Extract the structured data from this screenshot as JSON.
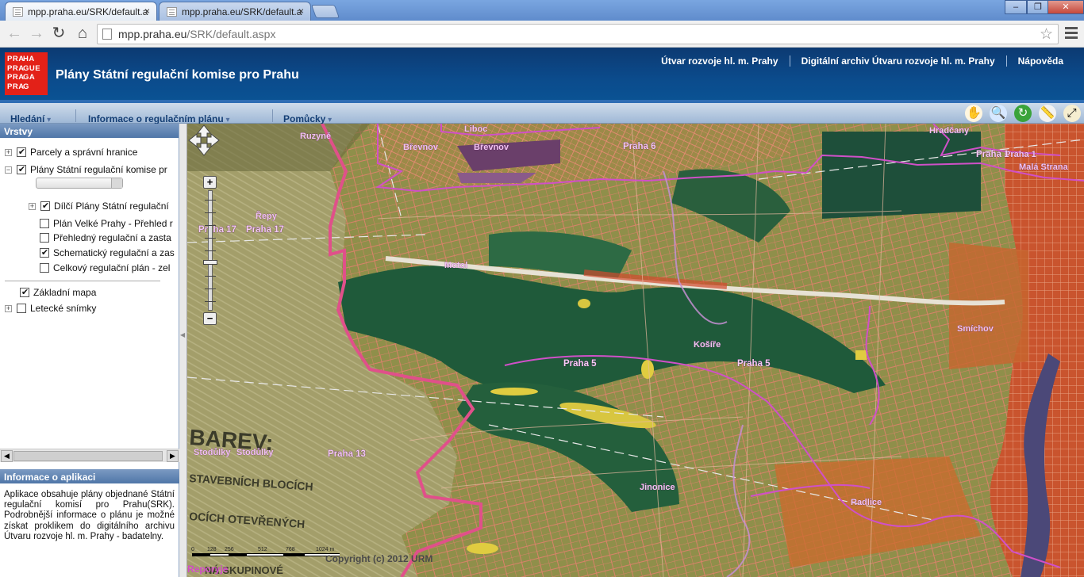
{
  "browser": {
    "tabs": [
      {
        "title": "mpp.praha.eu/SRK/default.a",
        "close": "×"
      },
      {
        "title": "mpp.praha.eu/SRK/default.a",
        "close": "×"
      }
    ],
    "url_domain": "mpp.praha.eu",
    "url_path": "/SRK/default.aspx",
    "nav": {
      "back": "←",
      "forward": "→",
      "reload": "↻",
      "home": "⌂",
      "star": "☆"
    },
    "window": {
      "minimize": "–",
      "maximize": "❐",
      "close": "✕"
    }
  },
  "app": {
    "logo": [
      [
        "PRA",
        "HA"
      ],
      [
        "PRA",
        "GUE"
      ],
      [
        "PRA",
        "GA"
      ],
      [
        "PRA",
        "G"
      ]
    ],
    "title": "Plány Státní regulační komise pro Prahu",
    "links": [
      "Útvar rozvoje hl. m. Prahy",
      "Digitální archiv Útvaru rozvoje hl. m. Prahy",
      "Nápověda"
    ],
    "menu": [
      "Hledání",
      "Informace o regulačním plánu",
      "Pomůcky"
    ],
    "tools": [
      {
        "icon": "hand-icon",
        "glyph": "✋"
      },
      {
        "icon": "globe-search-icon",
        "glyph": "🔍"
      },
      {
        "icon": "refresh-icon",
        "glyph": "↻"
      },
      {
        "icon": "measure-icon",
        "glyph": "📏"
      },
      {
        "icon": "fullscreen-icon",
        "glyph": "⤢"
      }
    ]
  },
  "layers_panel": {
    "title": "Vrstvy",
    "items": [
      {
        "label": "Parcely a správní hranice",
        "checked": true,
        "expander": "+"
      },
      {
        "label": "Plány Státní regulační komise pr",
        "checked": true,
        "expander": "−"
      },
      {
        "label": "Dílčí Plány Státní regulační",
        "checked": true,
        "expander": "+"
      },
      {
        "label": "Plán Velké Prahy - Přehled r",
        "checked": false
      },
      {
        "label": "Přehledný regulační a zasta",
        "checked": false
      },
      {
        "label": "Schematický regulační a zas",
        "checked": true
      },
      {
        "label": "Celkový regulační plán - zel",
        "checked": false
      },
      {
        "label": "Základní mapa",
        "checked": true
      },
      {
        "label": "Letecké snímky",
        "checked": false,
        "expander": "+"
      }
    ],
    "opacity": 1.0
  },
  "info_panel": {
    "title": "Informace o aplikaci",
    "text": "Aplikace obsahuje plány objednané Státní regulační komisí pro Prahu(SRK). Podrobnější informace o plánu je možné získat proklikem do digitálního archivu Útvaru rozvoje hl. m. Prahy - badatelny."
  },
  "map": {
    "place_labels": [
      "Ruzyně",
      "Liboc",
      "Břevnov",
      "Břevnov",
      "Hradčany",
      "Řepy",
      "Motol",
      "Košíře",
      "Smíchov",
      "Stodůlky",
      "Stodůlky",
      "Jinonice",
      "Radlice",
      "Reporyje",
      "Malá Strana",
      "Praha 1"
    ],
    "district_labels": [
      "Praha 6",
      "Praha 1",
      "Praha 17",
      "Praha 17",
      "Praha 5",
      "Praha 5",
      "Praha 13"
    ],
    "scale_labels": [
      "0",
      "128",
      "256",
      "512",
      "768",
      "1024 m"
    ],
    "copyright": "Copyright (c) 2012 URM",
    "historic_text": [
      "BAREV:",
      "STAVEBNÍCH BLOCÍCH",
      "OCÍCH OTEVŘENÝCH",
      "NÁ SKUPINOVÉ"
    ],
    "zoom": {
      "plus": "+",
      "minus": "−"
    }
  }
}
